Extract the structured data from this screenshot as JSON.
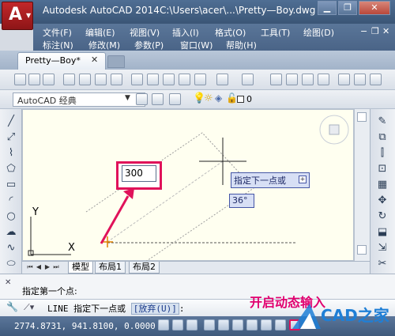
{
  "title": {
    "app": "Autodesk AutoCAD 2014",
    "file": "C:\\Users\\acer\\...\\Pretty—Boy.dwg"
  },
  "menus": {
    "row1": [
      "文件(F)",
      "编辑(E)",
      "视图(V)",
      "插入(I)",
      "格式(O)",
      "工具(T)",
      "绘图(D)"
    ],
    "row2": [
      "标注(N)",
      "修改(M)",
      "参数(P)",
      "窗口(W)",
      "帮助(H)"
    ]
  },
  "document_tab": {
    "label": "Pretty—Boy*",
    "close": "✕"
  },
  "workspace": {
    "label": "AutoCAD 经典"
  },
  "layer": {
    "name": "0"
  },
  "layout_tabs": [
    "模型",
    "布局1",
    "布局2"
  ],
  "dynamic_input": {
    "value": "300",
    "prompt": "指定下一点或",
    "angle": "36°"
  },
  "ucs": {
    "x": "X",
    "y": "Y"
  },
  "command": {
    "history": "指定第一个点:",
    "current_prefix": "LINE 指定下一点或",
    "option": "[放弃(U)]",
    "suffix": ":"
  },
  "caption": "开启动态输入",
  "status": {
    "coords": "2774.8731, 941.8100, 0.0000"
  },
  "logo": {
    "text": "CAD之家"
  },
  "colors": {
    "highlight": "#e0125a",
    "menubar": "#4a6487",
    "canvas": "#fffff0"
  }
}
